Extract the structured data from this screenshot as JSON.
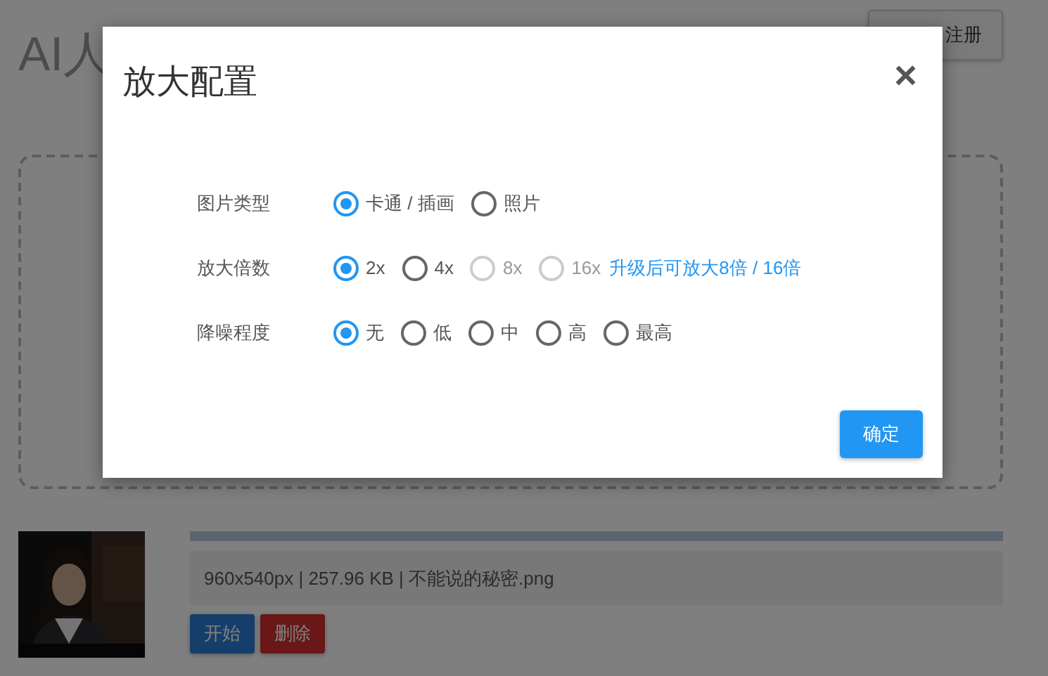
{
  "page": {
    "title": "AI人",
    "account_button": "注册"
  },
  "upload": {
    "progress": {
      "level": 1
    },
    "file_info": "960x540px | 257.96 KB | 不能说的秘密.png",
    "start_button": "开始",
    "delete_button": "删除"
  },
  "dialog": {
    "title": "放大配置",
    "close": "×",
    "rows": [
      {
        "label": "图片类型",
        "options": [
          {
            "label": "卡通 / 插画",
            "selected": true,
            "disabled": false
          },
          {
            "label": "照片",
            "selected": false,
            "disabled": false
          }
        ]
      },
      {
        "label": "放大倍数",
        "options": [
          {
            "label": "2x",
            "selected": true,
            "disabled": false
          },
          {
            "label": "4x",
            "selected": false,
            "disabled": false
          },
          {
            "label": "8x",
            "selected": false,
            "disabled": true
          },
          {
            "label": "16x",
            "selected": false,
            "disabled": true
          }
        ],
        "link": "升级后可放大8倍 / 16倍"
      },
      {
        "label": "降噪程度",
        "options": [
          {
            "label": "无",
            "selected": true,
            "disabled": false
          },
          {
            "label": "低",
            "selected": false,
            "disabled": false
          },
          {
            "label": "中",
            "selected": false,
            "disabled": false
          },
          {
            "label": "高",
            "selected": false,
            "disabled": false
          },
          {
            "label": "最高",
            "selected": false,
            "disabled": false
          }
        ]
      }
    ],
    "confirm_button": "确定"
  }
}
